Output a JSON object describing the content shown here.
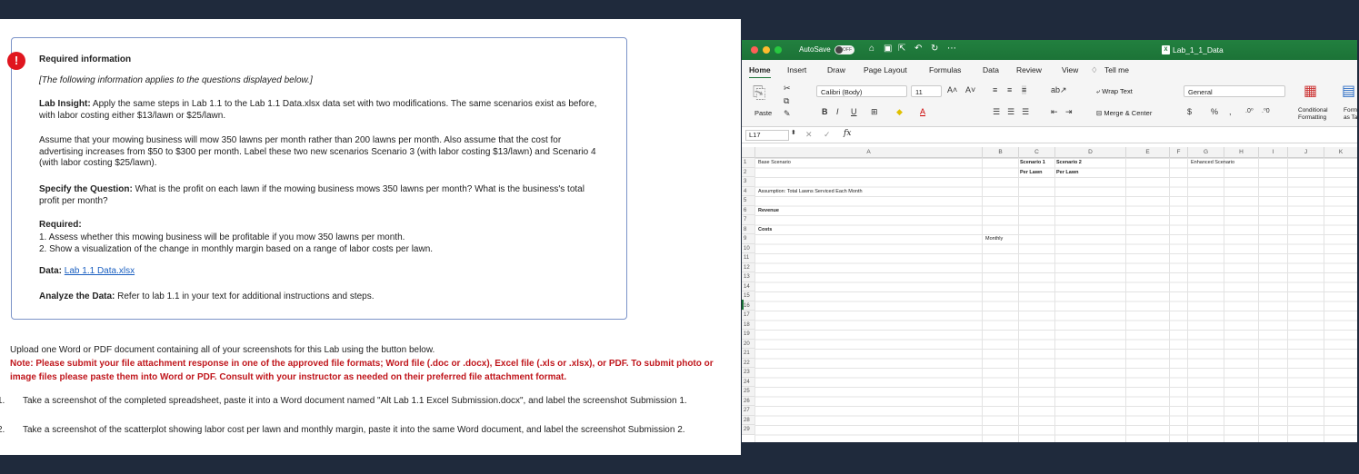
{
  "left_panel": {
    "alert_badge": "!",
    "info_title": "Required information",
    "info_intro": "[The following information applies to the questions displayed below.]",
    "lab_insight_label": "Lab Insight:",
    "lab_insight_text": " Apply the same steps in Lab 1.1 to the Lab 1.1 Data.xlsx data set with two modifications. The same scenarios exist as before, with labor costing either $13/lawn or $25/lawn.",
    "assume_text": "Assume that your mowing business will mow 350 lawns per month rather than 200 lawns per month. Also assume that the cost for advertising increases from $50 to $300 per month. Label these two new scenarios Scenario 3 (with labor costing $13/lawn) and Scenario 4 (with labor costing $25/lawn).",
    "specify_label": "Specify the Question:",
    "specify_text": " What is the profit on each lawn if the mowing business mows 350 lawns per month? What is the business's total profit per month?",
    "required_label": "Required:",
    "required_items": [
      "1. Assess whether this mowing business will be profitable if you mow 350 lawns per month.",
      "2. Show a visualization of the change in monthly margin based on a range of labor costs per lawn."
    ],
    "data_label": "Data:",
    "data_link": "Lab 1.1 Data.xlsx",
    "analyze_label": "Analyze the Data:",
    "analyze_text": " Refer to lab 1.1 in your text for additional instructions and steps.",
    "upload_line": "Upload one Word or PDF document containing all of your screenshots for this Lab using the button below.",
    "note_line": "Note: Please submit your file attachment response in one of the approved file formats; Word file (.doc or .docx), Excel file (.xls or .xlsx), or PDF. To submit photo or image files please paste them into Word or PDF. Consult with your instructor as needed on their preferred file attachment format.",
    "steps": [
      {
        "num": "1.",
        "text": "Take a screenshot of the completed spreadsheet, paste it into a Word document named \"Alt Lab 1.1 Excel Submission.docx\", and label the screenshot Submission 1."
      },
      {
        "num": "2.",
        "text": "Take a screenshot of the scatterplot showing labor cost per lawn and monthly margin, paste it into the same Word document, and label the screenshot Submission 2."
      }
    ]
  },
  "excel": {
    "autosave_label": "AutoSave",
    "autosave_state": "OFF",
    "file_title": "Lab_1_1_Data",
    "ribbon_tabs": [
      "Home",
      "Insert",
      "Draw",
      "Page Layout",
      "Formulas",
      "Data",
      "Review",
      "View"
    ],
    "tell_me": "Tell me",
    "paste_label": "Paste",
    "font_name": "Calibri (Body)",
    "font_size": "11",
    "wrap_text": "Wrap Text",
    "merge_center": "Merge & Center",
    "number_format": "General",
    "conditional_formatting": "Conditional Formatting",
    "format_as": "Form as Ta",
    "name_box": "L17",
    "fx": "fx",
    "columns": [
      "A",
      "B",
      "C",
      "D",
      "E",
      "F",
      "G",
      "H",
      "I",
      "J",
      "K"
    ],
    "rows": [
      "1",
      "2",
      "3",
      "4",
      "5",
      "6",
      "7",
      "8",
      "9",
      "10",
      "11",
      "12",
      "13",
      "14",
      "15",
      "16",
      "17",
      "18",
      "19",
      "20",
      "21",
      "22",
      "23",
      "24",
      "25",
      "26",
      "27",
      "28",
      "29"
    ],
    "cells": {
      "a1": "Base Scenario",
      "c1": "Scenario 1",
      "d1": "Scenario 2",
      "g1": "Enhanced Scenario",
      "c2": "Per Lawn",
      "d2": "Per Lawn",
      "a4": "Assumption: Total Lawns Serviced Each Month",
      "a6": "Revenue",
      "a8": "Costs",
      "b9": "Monthly"
    },
    "accent_color": "#1c7337"
  }
}
